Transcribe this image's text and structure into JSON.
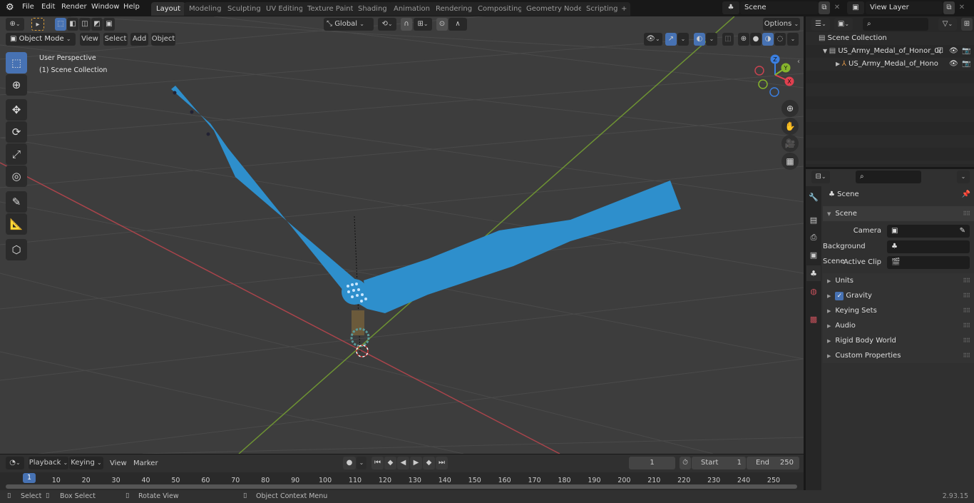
{
  "topbar": {
    "menus": [
      "File",
      "Edit",
      "Render",
      "Window",
      "Help"
    ],
    "workspaces": [
      "Layout",
      "Modeling",
      "Sculpting",
      "UV Editing",
      "Texture Paint",
      "Shading",
      "Animation",
      "Rendering",
      "Compositing",
      "Geometry Nodes",
      "Scripting"
    ],
    "active_workspace": "Layout",
    "add_tab": "+",
    "scene_name": "Scene",
    "view_layer": "View Layer"
  },
  "viewport": {
    "mode": "Object Mode",
    "menus": [
      "View",
      "Select",
      "Add",
      "Object"
    ],
    "transform_orientation": "Global",
    "options_label": "Options",
    "overlay_line1": "User Perspective",
    "overlay_line2": "(1) Scene Collection",
    "gizmo_axes": {
      "x": "X",
      "y": "Y",
      "z": "Z"
    },
    "colors": {
      "ribbon": "#2e8fcc",
      "x_axis": "#c2444f",
      "y_axis": "#7fa83a",
      "accent": "#4772b3"
    }
  },
  "outliner": {
    "root": "Scene Collection",
    "items": [
      {
        "name": "US_Army_Medal_of_Honor_0(",
        "level": 1
      },
      {
        "name": "US_Army_Medal_of_Hono",
        "level": 2
      }
    ]
  },
  "properties": {
    "header": "Scene",
    "section": "Scene",
    "fields": [
      {
        "label": "Camera",
        "value": ""
      },
      {
        "label": "Background Scene",
        "value": ""
      },
      {
        "label": "Active Clip",
        "value": ""
      }
    ],
    "panels": [
      "Units",
      "Gravity",
      "Keying Sets",
      "Audio",
      "Rigid Body World",
      "Custom Properties"
    ],
    "gravity_checked": true
  },
  "timeline": {
    "menus": [
      "Playback",
      "Keying",
      "View",
      "Marker"
    ],
    "current_frame": "1",
    "start_label": "Start",
    "start": "1",
    "end_label": "End",
    "end": "250",
    "ticks": [
      "10",
      "20",
      "30",
      "40",
      "50",
      "60",
      "70",
      "80",
      "90",
      "100",
      "110",
      "120",
      "130",
      "140",
      "150",
      "160",
      "170",
      "180",
      "190",
      "200",
      "210",
      "220",
      "230",
      "240",
      "250"
    ],
    "playhead": "1"
  },
  "statusbar": {
    "hints": [
      "Select",
      "Box Select",
      "Rotate View",
      "Object Context Menu"
    ],
    "version": "2.93.15"
  }
}
